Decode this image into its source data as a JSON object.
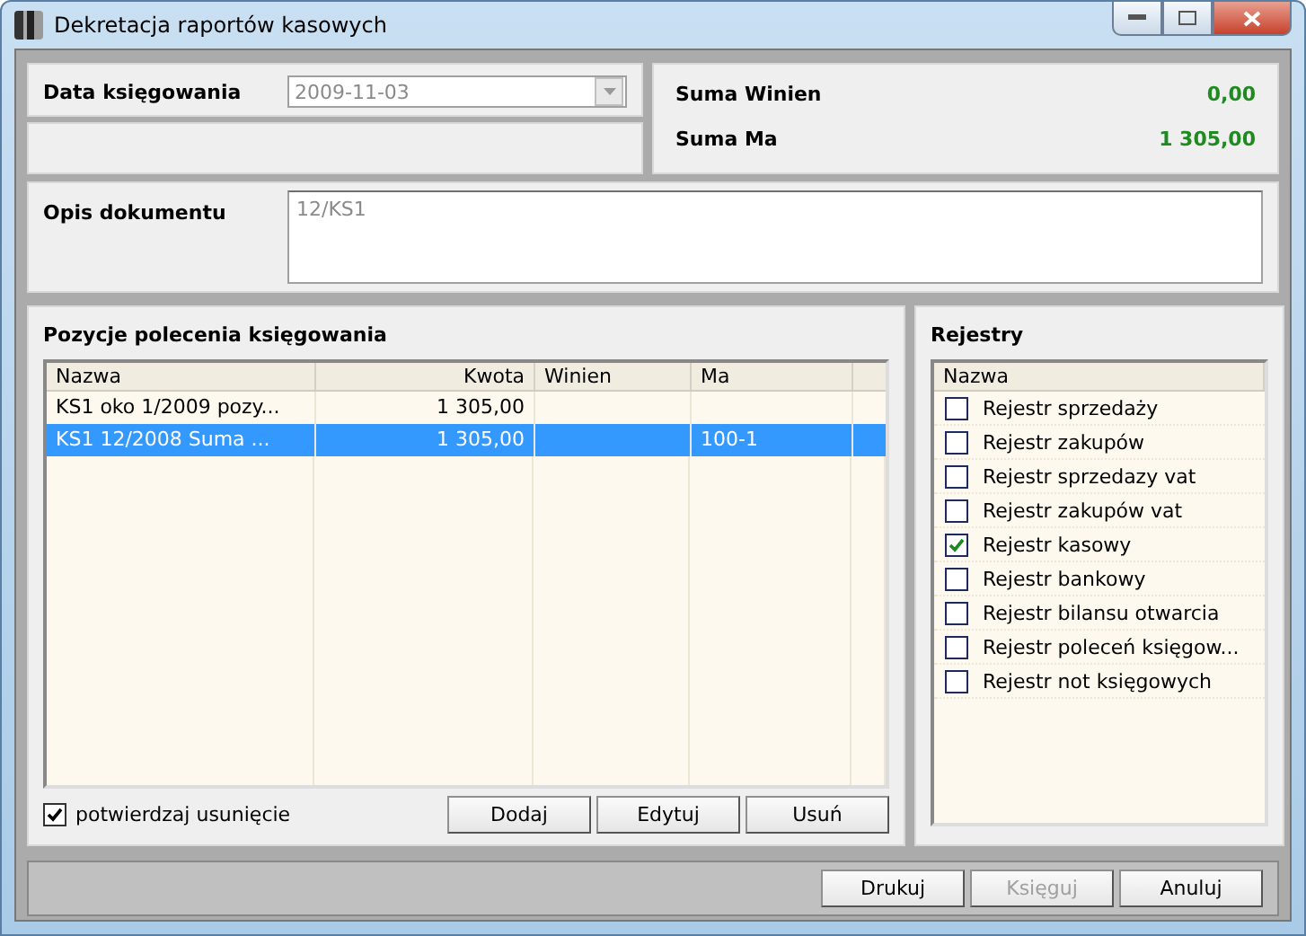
{
  "window": {
    "title": "Dekretacja raportów kasowych"
  },
  "date_field": {
    "label": "Data księgowania",
    "value": "2009-11-03",
    "disabled": true
  },
  "totals": [
    {
      "label": "Suma Winien",
      "value": "0,00"
    },
    {
      "label": "Suma Ma",
      "value": "1 305,00"
    }
  ],
  "description": {
    "label": "Opis dokumentu",
    "value": "12/KS1",
    "disabled": true
  },
  "entries": {
    "title": "Pozycje polecenia księgowania",
    "columns": [
      "Nazwa",
      "Kwota",
      "Winien",
      "Ma"
    ],
    "rows": [
      {
        "cells": [
          "KS1 oko 1/2009 pozy...",
          "1 305,00",
          "",
          ""
        ],
        "selected": false
      },
      {
        "cells": [
          "KS1 12/2008 Suma ...",
          "1 305,00",
          "",
          "100-1"
        ],
        "selected": true
      }
    ],
    "confirm_delete": {
      "label": "potwierdzaj usunięcie",
      "checked": true
    },
    "buttons": [
      "Dodaj",
      "Edytuj",
      "Usuń"
    ]
  },
  "registers": {
    "title": "Rejestry",
    "column": "Nazwa",
    "items": [
      {
        "label": "Rejestr sprzedaży",
        "checked": false
      },
      {
        "label": "Rejestr zakupów",
        "checked": false
      },
      {
        "label": "Rejestr sprzedazy vat",
        "checked": false
      },
      {
        "label": "Rejestr zakupów vat",
        "checked": false
      },
      {
        "label": "Rejestr kasowy",
        "checked": true
      },
      {
        "label": "Rejestr bankowy",
        "checked": false
      },
      {
        "label": "Rejestr bilansu otwarcia",
        "checked": false
      },
      {
        "label": "Rejestr poleceń księgow...",
        "checked": false
      },
      {
        "label": "Rejestr not księgowych",
        "checked": false
      }
    ]
  },
  "footer_buttons": [
    {
      "label": "Drukuj",
      "disabled": false
    },
    {
      "label": "Księguj",
      "disabled": true
    },
    {
      "label": "Anuluj",
      "disabled": false
    }
  ]
}
